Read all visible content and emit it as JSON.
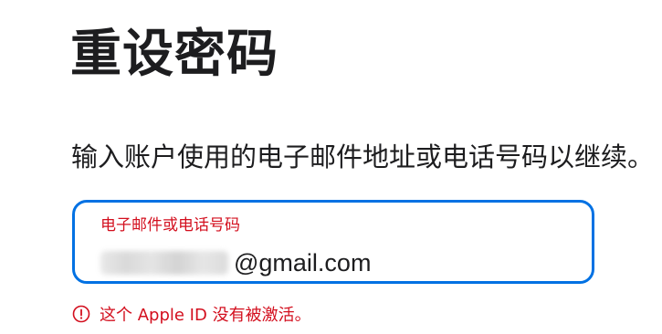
{
  "page": {
    "title": "重设密码",
    "instruction": "输入账户使用的电子邮件地址或电话号码以继续。"
  },
  "field": {
    "label": "电子邮件或电话号码",
    "value_visible": "@gmail.com"
  },
  "error": {
    "icon": "alert-circle-icon",
    "message": "这个 Apple ID 没有被激活。"
  },
  "colors": {
    "accent": "#0071e3",
    "error": "#d30f1e",
    "text": "#1d1d1f"
  }
}
